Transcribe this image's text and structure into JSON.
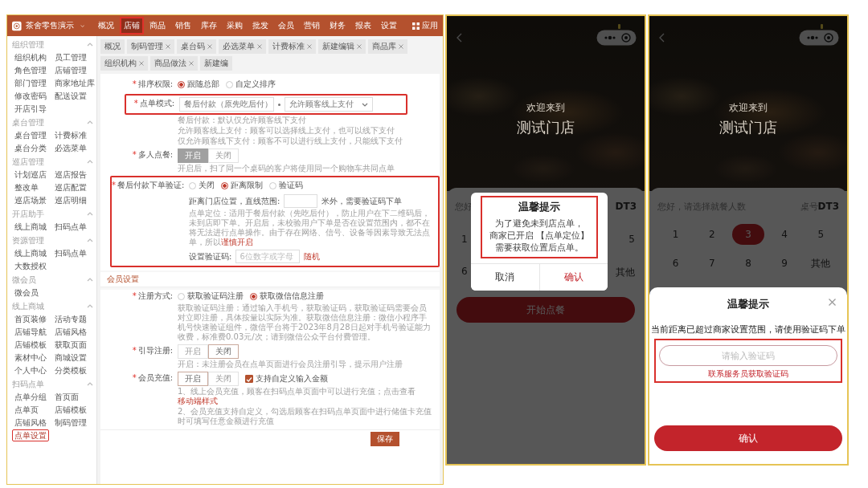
{
  "admin": {
    "brand": "茶舍零售演示",
    "nav": [
      {
        "label": "概况",
        "selected": false
      },
      {
        "label": "店铺",
        "selected": true
      },
      {
        "label": "商品",
        "selected": false
      },
      {
        "label": "销售",
        "selected": false
      },
      {
        "label": "库存",
        "selected": false
      },
      {
        "label": "采购",
        "selected": false
      },
      {
        "label": "批发",
        "selected": false
      },
      {
        "label": "会员",
        "selected": false
      },
      {
        "label": "营销",
        "selected": false
      },
      {
        "label": "财务",
        "selected": false
      },
      {
        "label": "报表",
        "selected": false
      },
      {
        "label": "设置",
        "selected": false
      }
    ],
    "apps_label": "应用",
    "tabs": [
      {
        "label": "概况",
        "closable": false
      },
      {
        "label": "制码管理",
        "closable": true
      },
      {
        "label": "桌台码",
        "closable": true
      },
      {
        "label": "必选菜单",
        "closable": true
      },
      {
        "label": "计费标准",
        "closable": true
      },
      {
        "label": "新建编辑",
        "closable": true
      },
      {
        "label": "商品库",
        "closable": true
      },
      {
        "label": "组织机构",
        "closable": true
      },
      {
        "label": "商品做法",
        "closable": true
      },
      {
        "label": "新建编",
        "closable": false
      }
    ],
    "sidebar": [
      {
        "title": "组织管理",
        "expanded": true,
        "items": [
          {
            "label": "组织机构",
            "selected": false
          },
          {
            "label": "员工管理",
            "selected": false
          },
          {
            "label": "角色管理",
            "selected": false
          },
          {
            "label": "店铺管理",
            "selected": false
          },
          {
            "label": "部门管理",
            "selected": false
          },
          {
            "label": "商家地址库",
            "selected": false
          },
          {
            "label": "修改密码",
            "selected": false
          },
          {
            "label": "配送设置",
            "selected": false
          },
          {
            "label": "开店引导",
            "selected": false
          }
        ]
      },
      {
        "title": "桌台管理",
        "expanded": true,
        "items": [
          {
            "label": "桌台管理",
            "selected": false
          },
          {
            "label": "计费标准",
            "selected": false
          },
          {
            "label": "桌台分类",
            "selected": false
          },
          {
            "label": "必选菜单",
            "selected": false
          }
        ]
      },
      {
        "title": "巡店管理",
        "expanded": true,
        "items": [
          {
            "label": "计划巡店",
            "selected": false
          },
          {
            "label": "巡店报告",
            "selected": false
          },
          {
            "label": "整改单",
            "selected": false
          },
          {
            "label": "巡店配置",
            "selected": false
          },
          {
            "label": "巡店场景",
            "selected": false
          },
          {
            "label": "巡店明细",
            "selected": false
          }
        ]
      },
      {
        "title": "开店助手",
        "expanded": true,
        "items": [
          {
            "label": "线上商城",
            "selected": false
          },
          {
            "label": "扫码点单",
            "selected": false
          }
        ]
      },
      {
        "title": "资源管理",
        "expanded": true,
        "items": [
          {
            "label": "线上商城",
            "selected": false
          },
          {
            "label": "扫码点单",
            "selected": false
          },
          {
            "label": "大数授权",
            "selected": false
          }
        ]
      },
      {
        "title": "微会员",
        "expanded": true,
        "items": [
          {
            "label": "微会员",
            "selected": false
          }
        ]
      },
      {
        "title": "线上商城",
        "expanded": true,
        "items": [
          {
            "label": "首页装修",
            "selected": false
          },
          {
            "label": "活动专题",
            "selected": false
          },
          {
            "label": "店铺导航",
            "selected": false
          },
          {
            "label": "店铺风格",
            "selected": false
          },
          {
            "label": "店铺模板",
            "selected": false
          },
          {
            "label": "获取页面",
            "selected": false
          },
          {
            "label": "素材中心",
            "selected": false
          },
          {
            "label": "商城设置",
            "selected": false
          },
          {
            "label": "个人中心",
            "selected": false
          },
          {
            "label": "分类模板",
            "selected": false
          }
        ]
      },
      {
        "title": "扫码点单",
        "expanded": true,
        "items": [
          {
            "label": "点单分组",
            "selected": false
          },
          {
            "label": "首页面",
            "selected": false
          },
          {
            "label": "点单页",
            "selected": false
          },
          {
            "label": "店铺模板",
            "selected": false
          },
          {
            "label": "店铺风格",
            "selected": false
          },
          {
            "label": "制码管理",
            "selected": false
          },
          {
            "label": "点单设置",
            "selected": true
          }
        ]
      }
    ],
    "form": {
      "sort_rule": {
        "mark": "*",
        "label": "排序权限:",
        "options": [
          {
            "label": "跟随总部",
            "selected": true
          },
          {
            "label": "自定义排序",
            "selected": false
          }
        ]
      },
      "order_mode": {
        "mark": "*",
        "label": "点单模式:",
        "select_1": "餐后付款（原先吃后付）",
        "select_2": "允许顾客线上支付",
        "hints": [
          "餐后付款：默认仅允许顾客线下支付",
          "允许顾客线上支付：顾客可以选择线上支付，也可以线下支付",
          "仅允许顾客线下支付：顾客不可以进行线上支付，只能线下支付"
        ]
      },
      "group_order": {
        "mark": "*",
        "label": "多人点餐:",
        "disabled": true,
        "options": [
          {
            "label": "开启",
            "selected": true
          },
          {
            "label": "关闭",
            "selected": false
          }
        ],
        "hint": "开启后，扫了同一个桌码的客户将使用同一个购物车共同点单"
      },
      "verify": {
        "mark": "*",
        "label": "餐后付款下单验证:",
        "options": [
          {
            "label": "关闭",
            "selected": false
          },
          {
            "label": "距离限制",
            "selected": true
          },
          {
            "label": "验证码",
            "selected": false
          }
        ],
        "distance_label": "距离门店位置，直线范围:",
        "distance_unit": "米外，需要验证码下单",
        "note": "点单定位：适用于餐后付款（先吃后付），防止用户在下二维码后，未到店即下单。开启后，未校验用户下单是否在设置范围内，都不在将无法进行点单操作。由于存在网络、信号、设备等因素导致无法点单，所以",
        "note_link": "谨慎开启",
        "code_label": "设置验证码:",
        "code_placeholder": "6位数字或字母",
        "random_link": "随机"
      }
    },
    "member": {
      "title": "会员设置",
      "register": {
        "mark": "*",
        "label": "注册方式:",
        "options": [
          {
            "label": "获取验证码注册",
            "selected": false
          },
          {
            "label": "获取微信信息注册",
            "selected": true
          }
        ],
        "note": "获取验证码注册：通过输入手机号，获取验证码，获取验证码需要会员对立即注册，具体按量以实际为准。获取微信信息注册：微信小程序手机号快速验证组件，微信平台将于2023年8月28日起对手机号验证能力收费，标准费0.03元/次；请到微信公众平台付费管理。"
      },
      "guide": {
        "mark": "*",
        "label": "引导注册:",
        "options": [
          {
            "label": "开启",
            "selected": false
          },
          {
            "label": "关闭",
            "selected": true
          }
        ],
        "hint": "开启：未注册会员在点单页面进行会员注册引导，提示用户注册"
      },
      "recharge": {
        "mark": "*",
        "label": "会员充值:",
        "options": [
          {
            "label": "开启",
            "selected": true
          },
          {
            "label": "关闭",
            "selected": false
          }
        ],
        "custom_amount": {
          "label": "支持自定义输入金额",
          "checked": true
        },
        "note_1": "1、线上会员充值，顾客在扫码点单页面中可以进行充值；点击查看",
        "note_1_link": "移动端样式",
        "note_2": "2、会员充值支持自定义，勾选后顾客在扫码点单页面中进行储值卡充值时可填写任意金额进行充值"
      }
    },
    "save_button": "保存"
  },
  "phone_1": {
    "welcome": "欢迎来到",
    "store": "测试门店",
    "greeting": "您好",
    "table_no": "DT3",
    "row_1": [
      "1",
      "5"
    ],
    "row_2": [
      "6",
      "其他"
    ],
    "start_button": "开始点餐",
    "dialog": {
      "title": "温馨提示",
      "lines": [
        "为了避免未到店点单，",
        "商家已开启 【点单定位】",
        "需要获取位置后点单。"
      ],
      "cancel": "取消",
      "confirm": "确认"
    }
  },
  "phone_2": {
    "welcome": "欢迎来到",
    "store": "测试门店",
    "greeting": "您好，请选择就餐人数",
    "table_label": "桌号",
    "table_no": "DT3",
    "counts": [
      {
        "label": "1",
        "selected": false
      },
      {
        "label": "2",
        "selected": false
      },
      {
        "label": "3",
        "selected": true
      },
      {
        "label": "4",
        "selected": false
      },
      {
        "label": "5",
        "selected": false
      },
      {
        "label": "6",
        "selected": false
      },
      {
        "label": "7",
        "selected": false
      },
      {
        "label": "8",
        "selected": false
      },
      {
        "label": "9",
        "selected": false
      },
      {
        "label": "其他",
        "selected": false
      }
    ],
    "sheet": {
      "title": "温馨提示",
      "message": "当前距离已超过商家设置范围，请使用验证码下单",
      "placeholder": "请输入验证码",
      "help_link": "联系服务员获取验证码",
      "confirm": "确认"
    }
  }
}
